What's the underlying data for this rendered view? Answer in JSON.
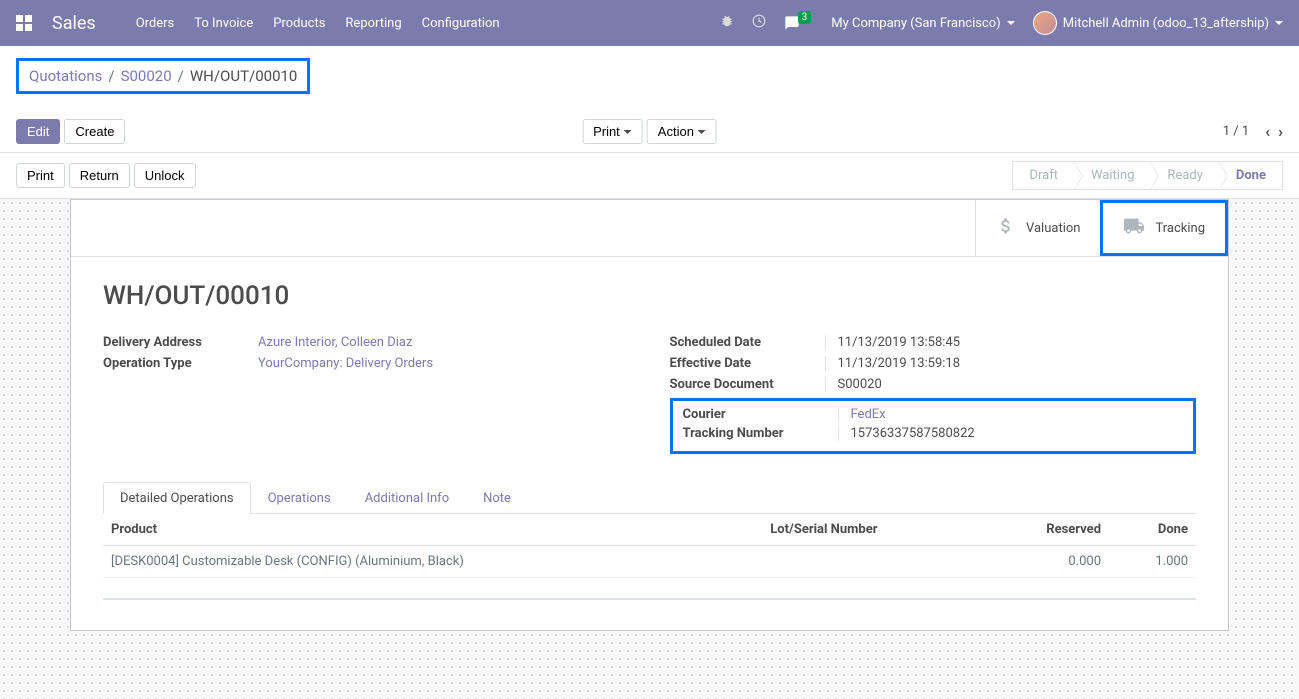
{
  "topbar": {
    "brand": "Sales",
    "menu": [
      "Orders",
      "To Invoice",
      "Products",
      "Reporting",
      "Configuration"
    ],
    "chat_count": "3",
    "company": "My Company (San Francisco)",
    "user": "Mitchell Admin (odoo_13_aftership)"
  },
  "breadcrumb": {
    "items": [
      "Quotations",
      "S00020"
    ],
    "active": "WH/OUT/00010"
  },
  "cp_buttons": {
    "edit": "Edit",
    "create": "Create",
    "print": "Print",
    "action": "Action"
  },
  "pager": {
    "text": "1 / 1"
  },
  "action_buttons": [
    "Print",
    "Return",
    "Unlock"
  ],
  "status_steps": [
    "Draft",
    "Waiting",
    "Ready",
    "Done"
  ],
  "stat_buttons": {
    "valuation": "Valuation",
    "tracking": "Tracking"
  },
  "record": {
    "title": "WH/OUT/00010",
    "left": {
      "delivery_address_label": "Delivery Address",
      "delivery_address_value": "Azure Interior, Colleen Diaz",
      "operation_type_label": "Operation Type",
      "operation_type_value": "YourCompany: Delivery Orders"
    },
    "right": {
      "scheduled_date_label": "Scheduled Date",
      "scheduled_date_value": "11/13/2019 13:58:45",
      "effective_date_label": "Effective Date",
      "effective_date_value": "11/13/2019 13:59:18",
      "source_document_label": "Source Document",
      "source_document_value": "S00020",
      "courier_label": "Courier",
      "courier_value": "FedEx",
      "tracking_number_label": "Tracking Number",
      "tracking_number_value": "15736337587580822"
    }
  },
  "tabs": [
    "Detailed Operations",
    "Operations",
    "Additional Info",
    "Note"
  ],
  "table": {
    "headers": {
      "product": "Product",
      "lot": "Lot/Serial Number",
      "reserved": "Reserved",
      "done": "Done"
    },
    "rows": [
      {
        "product": "[DESK0004] Customizable Desk (CONFIG) (Aluminium, Black)",
        "lot": "",
        "reserved": "0.000",
        "done": "1.000"
      }
    ]
  }
}
